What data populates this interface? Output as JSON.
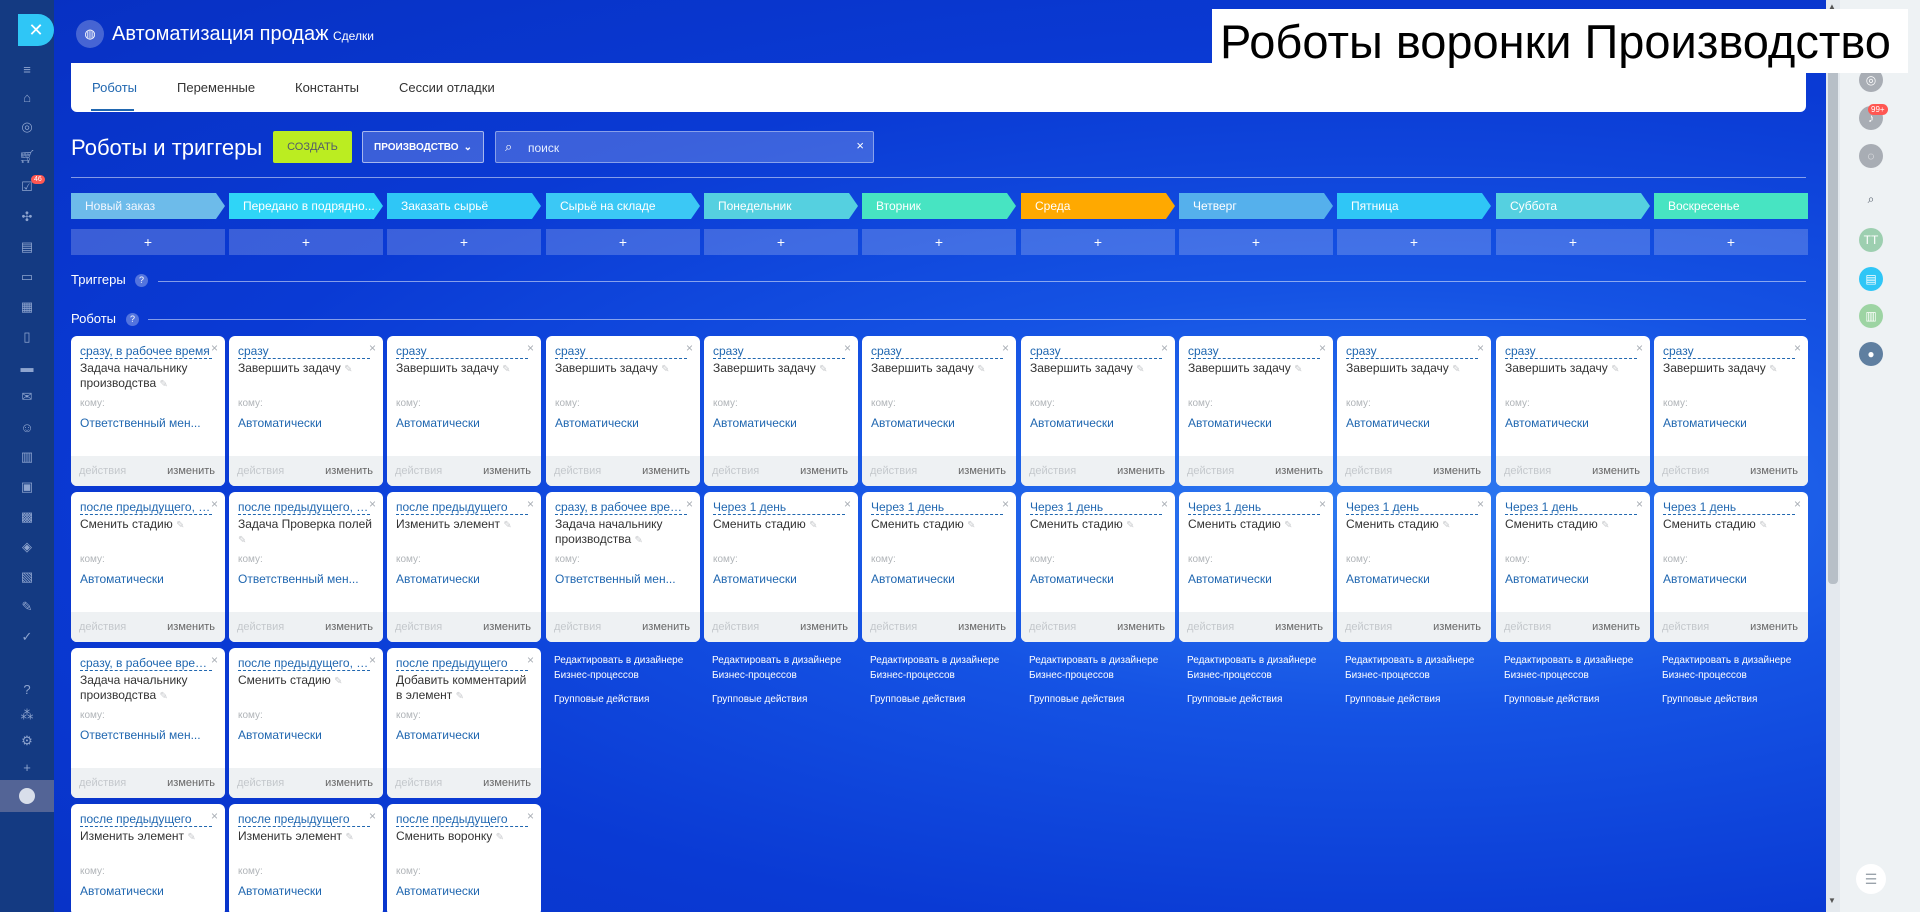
{
  "app": {
    "title": "Автоматизация продаж",
    "subtitle": "Сделки"
  },
  "overlay_title": "Роботы воронки Производство",
  "tabs": [
    "Роботы",
    "Переменные",
    "Константы",
    "Сессии отладки"
  ],
  "toolbar": {
    "title": "Роботы и триггеры",
    "create_label": "СОЗДАТЬ",
    "category_label": "ПРОИЗВОДСТВО",
    "search_placeholder": "поиск"
  },
  "stages": [
    {
      "name": "Новый заказ",
      "color": "#6dbbea"
    },
    {
      "name": "Передано в подрядно...",
      "color": "#2fd5f7"
    },
    {
      "name": "Заказать сырьё",
      "color": "#2fc6f6"
    },
    {
      "name": "Сырьё на складе",
      "color": "#3bc8f5"
    },
    {
      "name": "Понедельник",
      "color": "#55d0e0"
    },
    {
      "name": "Вторник",
      "color": "#47e4c2"
    },
    {
      "name": "Среда",
      "color": "#ffa900"
    },
    {
      "name": "Четверг",
      "color": "#55b0ec"
    },
    {
      "name": "Пятница",
      "color": "#2fc6f6"
    },
    {
      "name": "Суббота",
      "color": "#55d0e0"
    },
    {
      "name": "Воскресенье",
      "color": "#47e4c2"
    }
  ],
  "add_label": "+",
  "triggers_label": "Триггеры",
  "robots_label": "Роботы",
  "help_glyph": "?",
  "card_labels": {
    "to": "кому:",
    "actions": "действия",
    "change": "изменить",
    "close": "×",
    "pen": "✎"
  },
  "card_rows": [
    [
      {
        "when": "сразу, в рабочее время",
        "name": "Задача начальнику производства",
        "resp": "Ответственный мен..."
      },
      {
        "when": "сразу",
        "name": "Завершить задачу",
        "resp": "Автоматически"
      },
      {
        "when": "сразу",
        "name": "Завершить задачу",
        "resp": "Автоматически"
      },
      {
        "when": "сразу",
        "name": "Завершить задачу",
        "resp": "Автоматически"
      },
      {
        "when": "сразу",
        "name": "Завершить задачу",
        "resp": "Автоматически"
      },
      {
        "when": "сразу",
        "name": "Завершить задачу",
        "resp": "Автоматически"
      },
      {
        "when": "сразу",
        "name": "Завершить задачу",
        "resp": "Автоматически"
      },
      {
        "when": "сразу",
        "name": "Завершить задачу",
        "resp": "Автоматически"
      },
      {
        "when": "сразу",
        "name": "Завершить задачу",
        "resp": "Автоматически"
      },
      {
        "when": "сразу",
        "name": "Завершить задачу",
        "resp": "Автоматически"
      },
      {
        "when": "сразу",
        "name": "Завершить задачу",
        "resp": "Автоматически"
      }
    ],
    [
      {
        "when": "после предыдущего, п...",
        "name": "Сменить стадию",
        "resp": "Автоматически"
      },
      {
        "when": "после предыдущего, п...",
        "name": "Задача Проверка полей",
        "resp": "Ответственный мен..."
      },
      {
        "when": "после предыдущего",
        "name": "Изменить элемент",
        "resp": "Автоматически"
      },
      {
        "when": "сразу, в рабочее врем...",
        "name": "Задача начальнику производства",
        "resp": "Ответственный мен..."
      },
      {
        "when": "Через 1 день",
        "name": "Сменить стадию",
        "resp": "Автоматически"
      },
      {
        "when": "Через 1 день",
        "name": "Сменить стадию",
        "resp": "Автоматически"
      },
      {
        "when": "Через 1 день",
        "name": "Сменить стадию",
        "resp": "Автоматически"
      },
      {
        "when": "Через 1 день",
        "name": "Сменить стадию",
        "resp": "Автоматически"
      },
      {
        "when": "Через 1 день",
        "name": "Сменить стадию",
        "resp": "Автоматически"
      },
      {
        "when": "Через 1 день",
        "name": "Сменить стадию",
        "resp": "Автоматически"
      },
      {
        "when": "Через 1 день",
        "name": "Сменить стадию",
        "resp": "Автоматически"
      }
    ],
    [
      {
        "when": "сразу, в рабочее врем...",
        "name": "Задача начальнику производства",
        "resp": "Ответственный мен..."
      },
      {
        "when": "после предыдущего, п...",
        "name": "Сменить стадию",
        "resp": "Автоматически"
      },
      {
        "when": "после предыдущего",
        "name": "Добавить комментарий в элемент",
        "resp": "Автоматически"
      }
    ],
    [
      {
        "when": "после предыдущего",
        "name": "Изменить элемент",
        "resp": "Автоматически"
      },
      {
        "when": "после предыдущего",
        "name": "Изменить элемент",
        "resp": "Автоматически"
      },
      {
        "when": "после предыдущего",
        "name": "Сменить воронку",
        "resp": "Автоматически"
      }
    ]
  ],
  "links": {
    "designer": "Редактировать в дизайнере Бизнес-процессов",
    "group": "Групповые действия"
  },
  "right_panel": {
    "notifications_badge": "99+",
    "avatar_initials": "ТТ"
  },
  "left_panel": {
    "tasks_badge": "46"
  },
  "icons": [
    "close-icon",
    "filter-icon",
    "home-icon",
    "target-icon",
    "cart-icon",
    "checkbox-icon",
    "puzzle-icon",
    "document-icon",
    "chat-icon",
    "calendar-icon",
    "file-icon",
    "drive-icon",
    "mail-icon",
    "users-icon",
    "chart-icon",
    "contact-icon",
    "robot-icon",
    "box-icon",
    "form-icon",
    "sign-icon",
    "check-icon",
    "help-icon",
    "sitemap-icon",
    "gear-icon",
    "plus-icon",
    "crown-icon",
    "search-icon",
    "bell-icon",
    "list-icon"
  ]
}
